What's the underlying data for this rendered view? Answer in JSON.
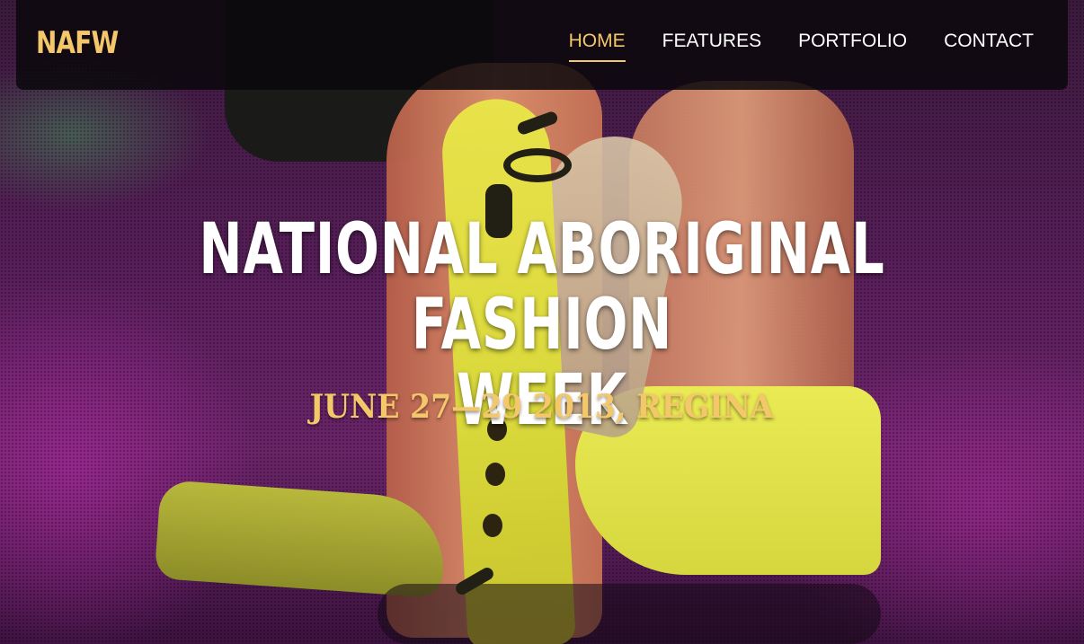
{
  "nav": {
    "brand": "NAFW",
    "items": [
      {
        "label": "HOME",
        "active": true
      },
      {
        "label": "FEATURES",
        "active": false
      },
      {
        "label": "PORTFOLIO",
        "active": false
      },
      {
        "label": "CONTACT",
        "active": false
      }
    ]
  },
  "hero": {
    "title_line1": "NATIONAL ABORIGINAL FASHION",
    "title_line2": "WEEK",
    "subtitle": "JUNE 27—29 2013, REGINA"
  },
  "colors": {
    "accent": "#f3c76a",
    "nav_bg": "#0a080c",
    "text": "#ffffff"
  }
}
